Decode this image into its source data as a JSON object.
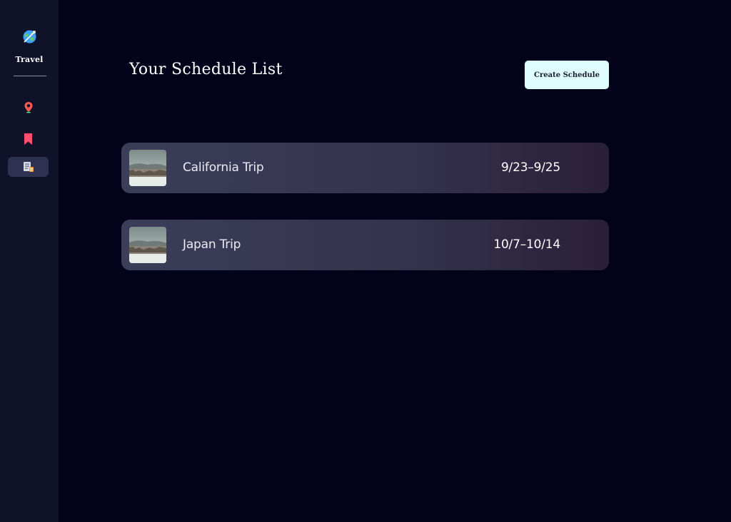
{
  "brand": {
    "name": "Travel",
    "logo_icon": "globe-icon"
  },
  "sidebar": {
    "items": [
      {
        "id": "locations",
        "icon": "map-pin-icon",
        "color": "#ff5c4d",
        "active": false
      },
      {
        "id": "bookmarks",
        "icon": "bookmark-icon",
        "color": "#ff4f6a",
        "active": false
      },
      {
        "id": "schedule",
        "icon": "schedule-list-icon",
        "color": "#b9bdd6",
        "active": true
      }
    ]
  },
  "main": {
    "title": "Your Schedule List",
    "create_button_label": "Create Schedule",
    "trips": [
      {
        "name": "California Trip",
        "dates": "9/23–9/25",
        "thumbnail": "landscape-thumbnail"
      },
      {
        "name": "Japan Trip",
        "dates": "10/7–10/14",
        "thumbnail": "landscape-thumbnail"
      }
    ]
  },
  "colors": {
    "background": "#02031a",
    "sidebar": "#10122a",
    "button_bg": "#dffcff",
    "card_start": "#3b3d59",
    "card_end": "#2a1f3a"
  }
}
